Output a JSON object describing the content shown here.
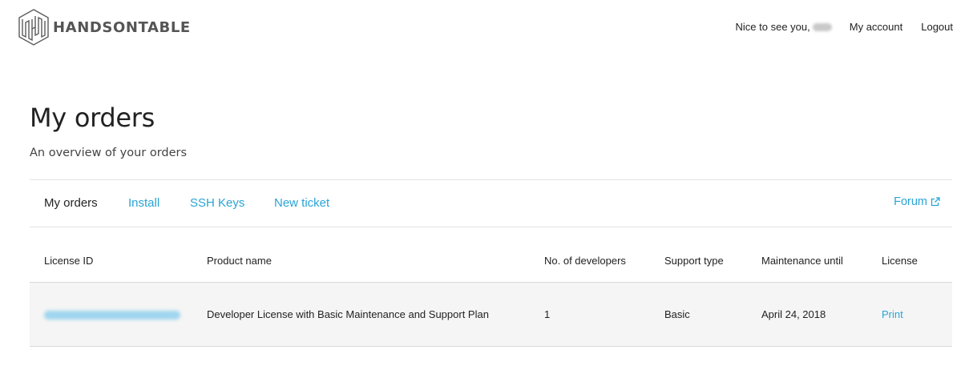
{
  "brand": {
    "name": "HANDSONTABLE",
    "logo_icon": "handsontable-logo-icon"
  },
  "header_nav": {
    "greeting": "Nice to see you,",
    "my_account": "My account",
    "logout": "Logout"
  },
  "page": {
    "title": "My orders",
    "subtitle": "An overview of your orders"
  },
  "tabs": [
    {
      "label": "My orders",
      "active": true
    },
    {
      "label": "Install",
      "active": false
    },
    {
      "label": "SSH Keys",
      "active": false
    },
    {
      "label": "New ticket",
      "active": false
    }
  ],
  "forum": {
    "label": "Forum",
    "icon": "external-link-icon"
  },
  "table": {
    "columns": [
      "License ID",
      "Product name",
      "No. of developers",
      "Support type",
      "Maintenance until",
      "License"
    ],
    "rows": [
      {
        "product_name": "Developer License with Basic Maintenance and Support Plan",
        "developers": "1",
        "support_type": "Basic",
        "maintenance_until": "April 24, 2018",
        "license_action": "Print"
      }
    ]
  },
  "colors": {
    "link": "#2aa4d5",
    "text": "#222222",
    "row_bg": "#f5f5f5",
    "rule": "#e2e2e2"
  }
}
